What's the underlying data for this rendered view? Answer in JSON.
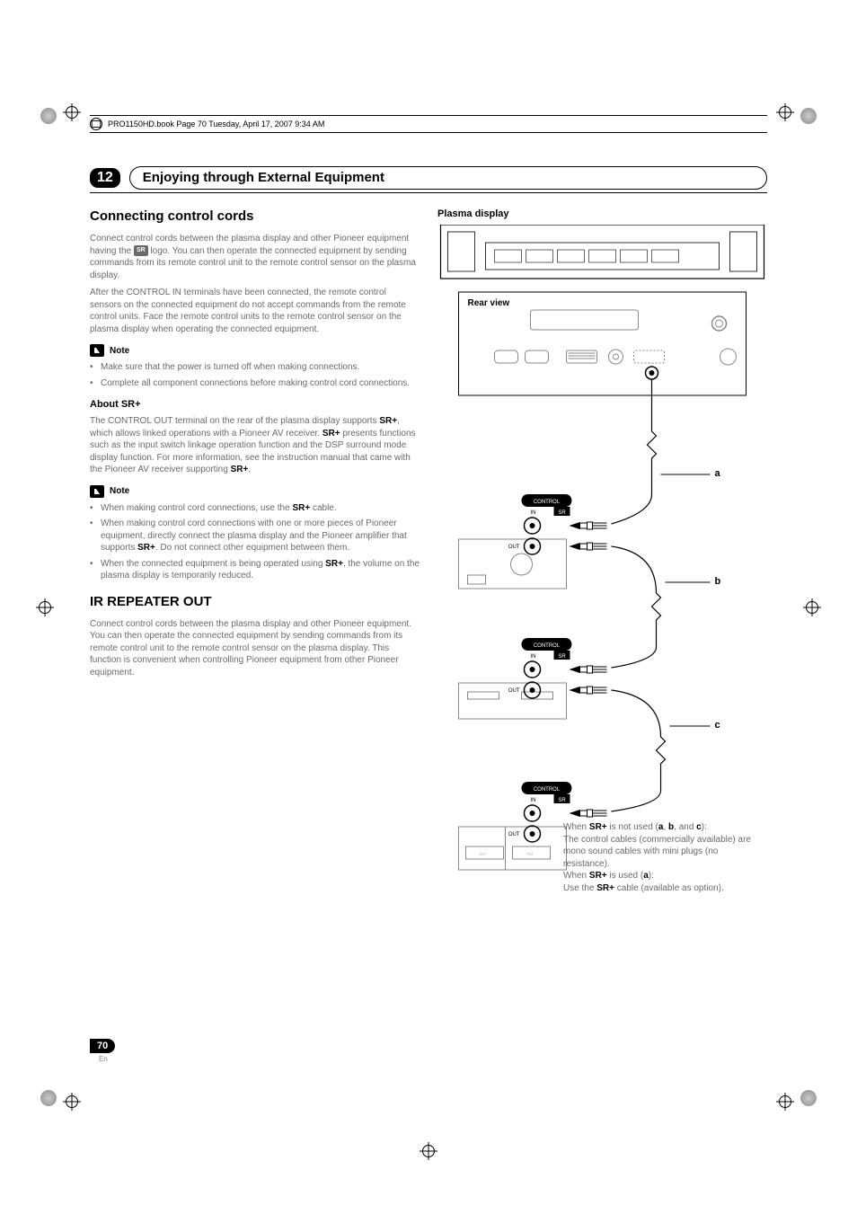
{
  "header": {
    "book_stamp": "PRO1150HD.book  Page 70  Tuesday, April 17, 2007  9:34 AM"
  },
  "chapter": {
    "number": "12",
    "title": "Enjoying through External Equipment"
  },
  "left": {
    "section1_title": "Connecting control cords",
    "p1_a": "Connect control cords between the plasma display and other Pioneer equipment having the ",
    "p1_logo": "SR",
    "p1_b": " logo. You can then operate the connected equipment by sending commands from its remote control unit to the remote control sensor on the plasma display.",
    "p2": "After the CONTROL IN terminals have been connected, the remote control sensors on the connected equipment do not accept commands from the remote control units. Face the remote control units to the remote control sensor on the plasma display when operating the connected equipment.",
    "note_label": "Note",
    "note1_b1": "Make sure that the power is turned off when making connections.",
    "note1_b2": "Complete all component connections before making control cord connections.",
    "about_sr_title": "About SR+",
    "about_sr_p_a": "The CONTROL OUT terminal on the rear of the plasma display supports ",
    "about_sr_p_b": "SR+",
    "about_sr_p_c": ", which allows linked operations with a Pioneer AV receiver. ",
    "about_sr_p_d": "SR+",
    "about_sr_p_e": " presents functions such as the input switch linkage operation function and the DSP surround mode display function. For more information, see the instruction manual that came with the Pioneer AV receiver supporting ",
    "about_sr_p_f": "SR+",
    "about_sr_p_g": ".",
    "note2_b1_a": "When making control cord connections, use the ",
    "note2_b1_b": "SR+",
    "note2_b1_c": " cable.",
    "note2_b2_a": "When making control cord connections with one or more pieces of Pioneer equipment, directly connect the plasma display and the Pioneer amplifier that supports ",
    "note2_b2_b": "SR+",
    "note2_b2_c": ". Do not connect other equipment between them.",
    "note2_b3_a": "When the connected equipment is being operated using ",
    "note2_b3_b": "SR+",
    "note2_b3_c": ", the volume on the plasma display is temporarily reduced.",
    "section2_title": "IR REPEATER OUT",
    "ir_p": "Connect control cords between the plasma display and other Pioneer equipment. You can then operate the connected equipment by sending commands from its remote control unit to the remote control sensor on the plasma display. This function is convenient when controlling Pioneer equipment from other Pioneer equipment."
  },
  "right": {
    "diagram_title": "Plasma display",
    "rear_view": "Rear view",
    "label_a": "a",
    "label_b": "b",
    "label_c": "c",
    "control_label": "CONTROL",
    "in_label": "IN",
    "out_label": "OUT",
    "sr_badge": "SR",
    "note_a1": "When ",
    "note_a2": "SR+",
    "note_a3": " is not used (",
    "note_a4": "a",
    "note_a5": ", ",
    "note_a6": "b",
    "note_a7": ", and ",
    "note_a8": "c",
    "note_a9": "):",
    "note_b": "The control cables (commercially available) are mono sound cables with mini plugs (no resistance).",
    "note_c1": "When ",
    "note_c2": "SR+",
    "note_c3": " is used (",
    "note_c4": "a",
    "note_c5": "):",
    "note_d1": "Use the ",
    "note_d2": "SR+",
    "note_d3": " cable (available as option)."
  },
  "footer": {
    "page": "70",
    "lang": "En"
  }
}
